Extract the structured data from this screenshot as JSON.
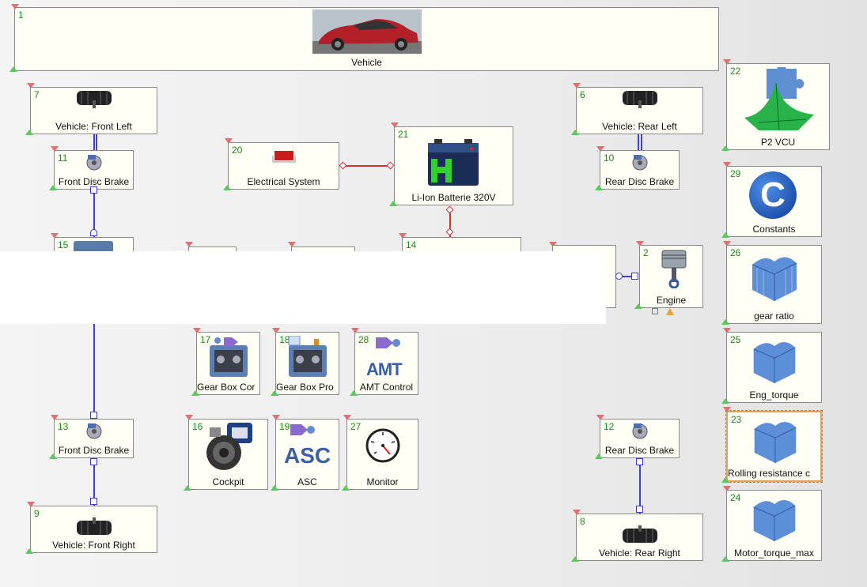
{
  "blocks": {
    "b1": {
      "num": "1",
      "label": "Vehicle"
    },
    "b7": {
      "num": "7",
      "label": "Vehicle: Front Left"
    },
    "b11": {
      "num": "11",
      "label": "Front Disc Brake"
    },
    "b20": {
      "num": "20",
      "label": "Electrical System"
    },
    "b21": {
      "num": "21",
      "label": "Li-Ion Batterie 320V"
    },
    "b6": {
      "num": "6",
      "label": "Vehicle: Rear Left"
    },
    "b10": {
      "num": "10",
      "label": "Rear Disc Brake"
    },
    "b22": {
      "num": "22",
      "label": "P2 VCU"
    },
    "b29": {
      "num": "29",
      "label": "Constants"
    },
    "b15": {
      "num": "15",
      "label": ""
    },
    "b14": {
      "num": "14",
      "label": ""
    },
    "b2": {
      "num": "2",
      "label": "Engine"
    },
    "b26": {
      "num": "26",
      "label": "gear ratio"
    },
    "b17": {
      "num": "17",
      "label": "Gear Box Cor"
    },
    "b18": {
      "num": "18",
      "label": "Gear Box Pro"
    },
    "b28": {
      "num": "28",
      "label": "AMT Control"
    },
    "b25": {
      "num": "25",
      "label": "Eng_torque"
    },
    "b13": {
      "num": "13",
      "label": "Front Disc Brake"
    },
    "b16": {
      "num": "16",
      "label": "Cockpit"
    },
    "b19": {
      "num": "19",
      "label": "ASC"
    },
    "b27": {
      "num": "27",
      "label": "Monitor"
    },
    "b12": {
      "num": "12",
      "label": "Rear Disc Brake"
    },
    "b23": {
      "num": "23",
      "label": "Rolling resistance c"
    },
    "b9": {
      "num": "9",
      "label": "Vehicle: Front Right"
    },
    "b8": {
      "num": "8",
      "label": "Vehicle: Rear Right"
    },
    "b24": {
      "num": "24",
      "label": "Motor_torque_max"
    }
  },
  "icons": {
    "asc_text": "ASC",
    "amt_text": "AMT",
    "constants_text": "C"
  },
  "colors": {
    "block_bg": "#fffff5",
    "number": "#1f8a1f",
    "wire_mech": "#4040d0",
    "wire_elec": "#d03030",
    "selected_border": "#e0a060"
  }
}
